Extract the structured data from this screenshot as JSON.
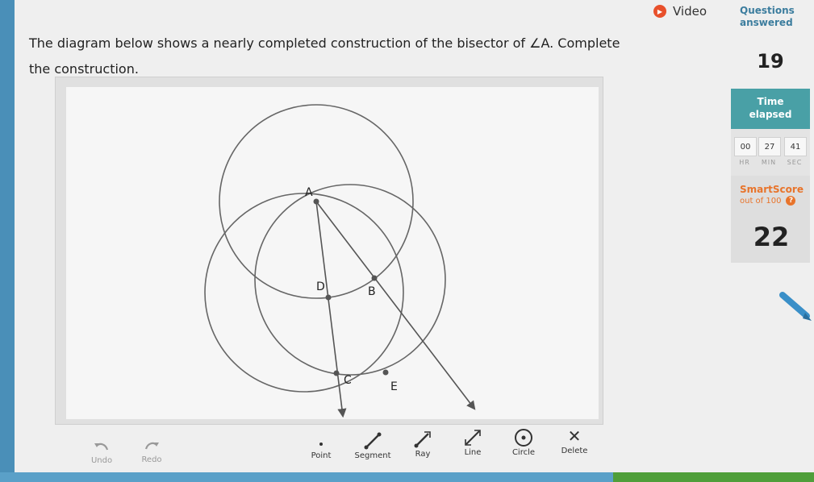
{
  "header": {
    "video_label": "Video",
    "play_icon": "play-icon"
  },
  "question": {
    "text": "The diagram below shows a nearly completed construction of the bisector of ∠A. Complete the construction."
  },
  "diagram": {
    "points": [
      {
        "label": "A"
      },
      {
        "label": "B"
      },
      {
        "label": "C"
      },
      {
        "label": "D"
      },
      {
        "label": "E"
      }
    ]
  },
  "toolbar": {
    "undo_label": "Undo",
    "redo_label": "Redo",
    "point_label": "Point",
    "segment_label": "Segment",
    "ray_label": "Ray",
    "line_label": "Line",
    "circle_label": "Circle",
    "delete_label": "Delete"
  },
  "sidebar": {
    "questions_label_line1": "Questions",
    "questions_label_line2": "answered",
    "questions_count": "19",
    "time_label_line1": "Time",
    "time_label_line2": "elapsed",
    "time_hr": "00",
    "time_min": "27",
    "time_sec": "41",
    "unit_hr": "HR",
    "unit_min": "MIN",
    "unit_sec": "SEC",
    "score_label": "SmartScore",
    "score_sub": "out of 100",
    "score_help": "?",
    "score_value": "22"
  },
  "colors": {
    "accent_teal": "#49a0a6",
    "score_orange": "#e8742b",
    "video_red": "#e8502b",
    "questions_blue": "#3c7d9e"
  }
}
